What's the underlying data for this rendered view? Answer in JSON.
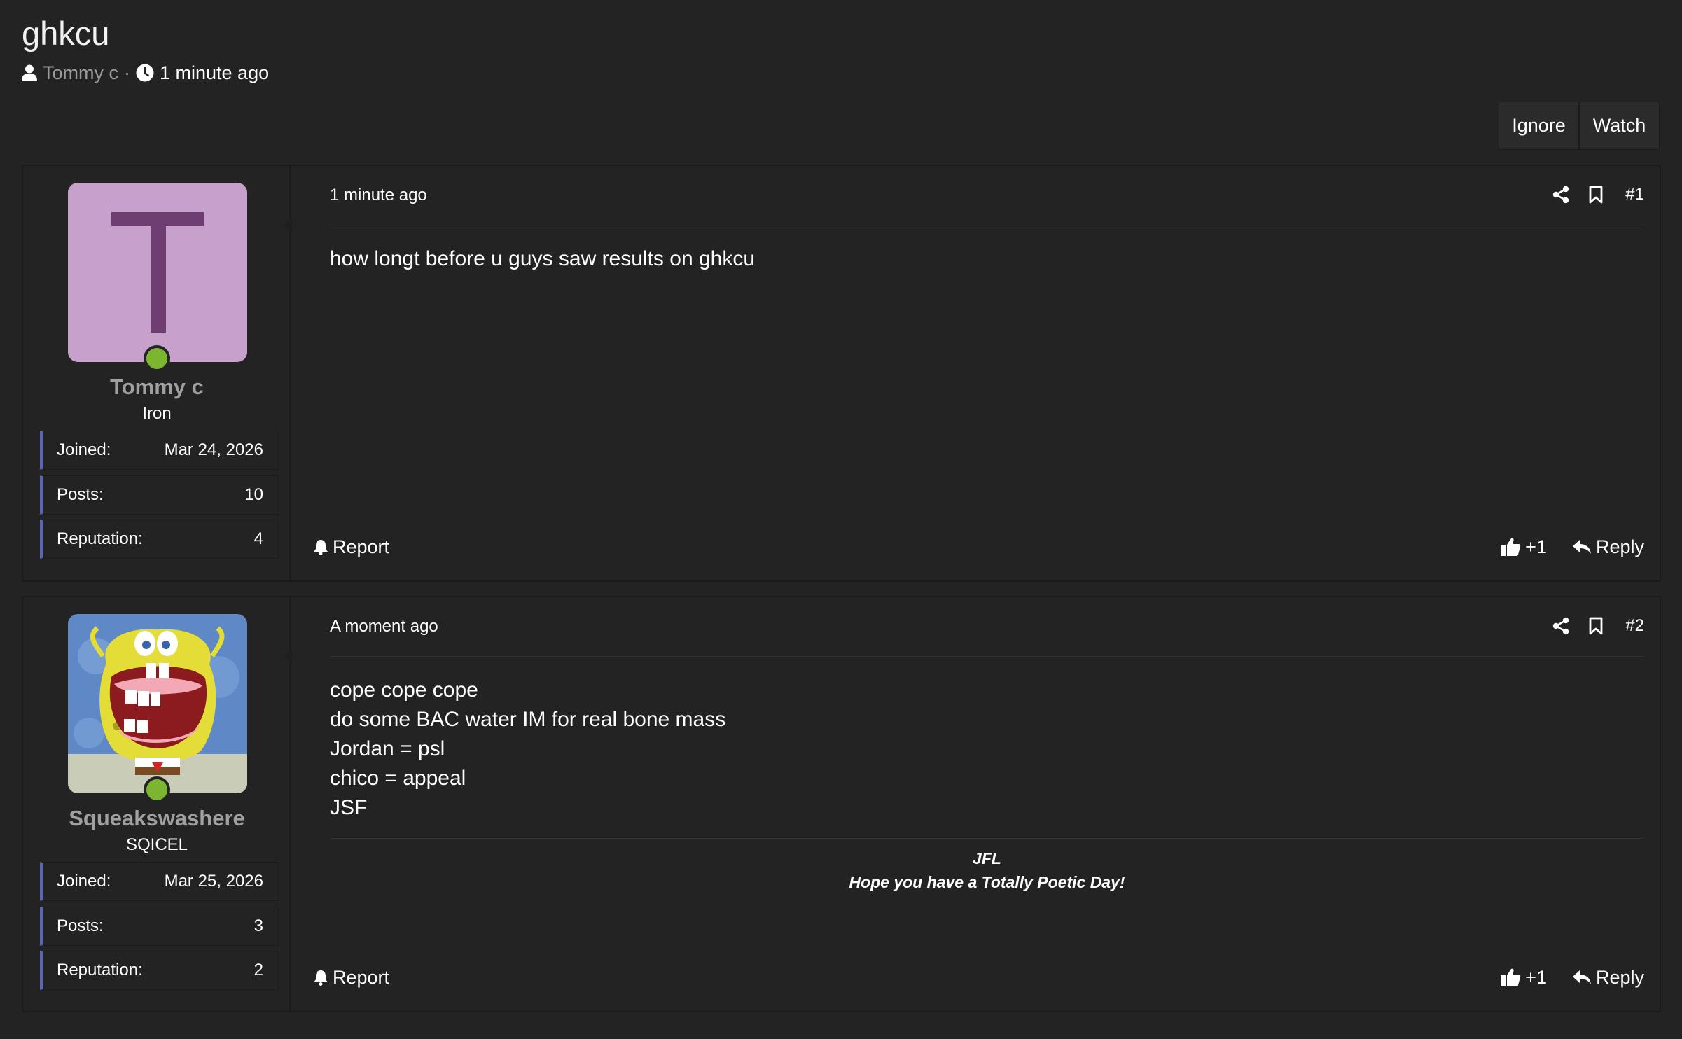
{
  "thread": {
    "title": "ghkcu",
    "author": "Tommy c",
    "separator": "·",
    "time": "1 minute ago",
    "actions": {
      "ignore": "Ignore",
      "watch": "Watch"
    }
  },
  "posts": [
    {
      "user": {
        "avatar_letter": "T",
        "avatar_color": "#c8a0cc",
        "avatar_letter_color": "#6e3d72",
        "name": "Tommy c",
        "title": "Iron",
        "online": true,
        "stats": [
          {
            "label": "Joined:",
            "value": "Mar 24, 2026"
          },
          {
            "label": "Posts:",
            "value": "10"
          },
          {
            "label": "Reputation:",
            "value": "4"
          }
        ]
      },
      "date": "1 minute ago",
      "number": "#1",
      "lines": [
        "how longt before u guys saw results on ghkcu"
      ],
      "footer": {
        "report": "Report",
        "like": "+1",
        "reply": "Reply"
      }
    },
    {
      "user": {
        "avatar_description": "cartoon sponge character avatar",
        "name": "Squeakswashere",
        "title": "SQICEL",
        "online": true,
        "stats": [
          {
            "label": "Joined:",
            "value": "Mar 25, 2026"
          },
          {
            "label": "Posts:",
            "value": "3"
          },
          {
            "label": "Reputation:",
            "value": "2"
          }
        ]
      },
      "date": "A moment ago",
      "number": "#2",
      "lines": [
        "cope cope cope",
        "do some BAC water IM for real bone mass",
        "Jordan = psl",
        "chico = appeal",
        "JSF"
      ],
      "signature": [
        "JFL",
        "Hope you have a Totally Poetic Day!"
      ],
      "footer": {
        "report": "Report",
        "like": "+1",
        "reply": "Reply"
      }
    }
  ],
  "colors": {
    "background": "#232323",
    "online": "#7cb631",
    "stat_accent": "#5b64c6",
    "username": "#a0a0a0"
  }
}
